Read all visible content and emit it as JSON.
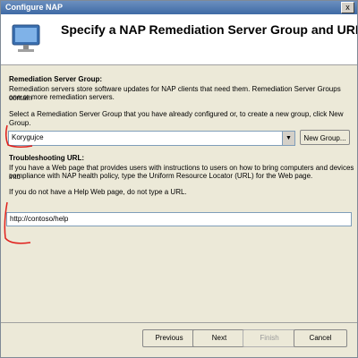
{
  "window": {
    "title": "Configure NAP",
    "close_glyph": "x"
  },
  "header": {
    "title": "Specify a NAP Remediation Server Group and URL",
    "icon": "computer-monitor-icon"
  },
  "rsg": {
    "heading": "Remediation Server Group:",
    "desc1": "Remediation servers store software updates for NAP clients that need them. Remediation Server Groups contain",
    "desc2": "one or more remediation servers.",
    "instruction": "Select a Remediation Server Group that you have already configured or, to create a new group, click New Group.",
    "selected": "Korygujce",
    "new_group_label": "New Group..."
  },
  "troubleshooting": {
    "heading": "Troubleshooting URL:",
    "desc1": "If you have a Web page that provides users with instructions to users on how to bring computers and devices into",
    "desc2": "compliance with NAP health policy, type the Uniform Resource Locator (URL) for the Web page.",
    "note": "If you do not have a Help Web page, do not type a URL.",
    "url_value": "http://contoso/help"
  },
  "footer": {
    "previous": "Previous",
    "next": "Next",
    "finish": "Finish",
    "cancel": "Cancel"
  },
  "colors": {
    "annotation": "#e0201c"
  }
}
